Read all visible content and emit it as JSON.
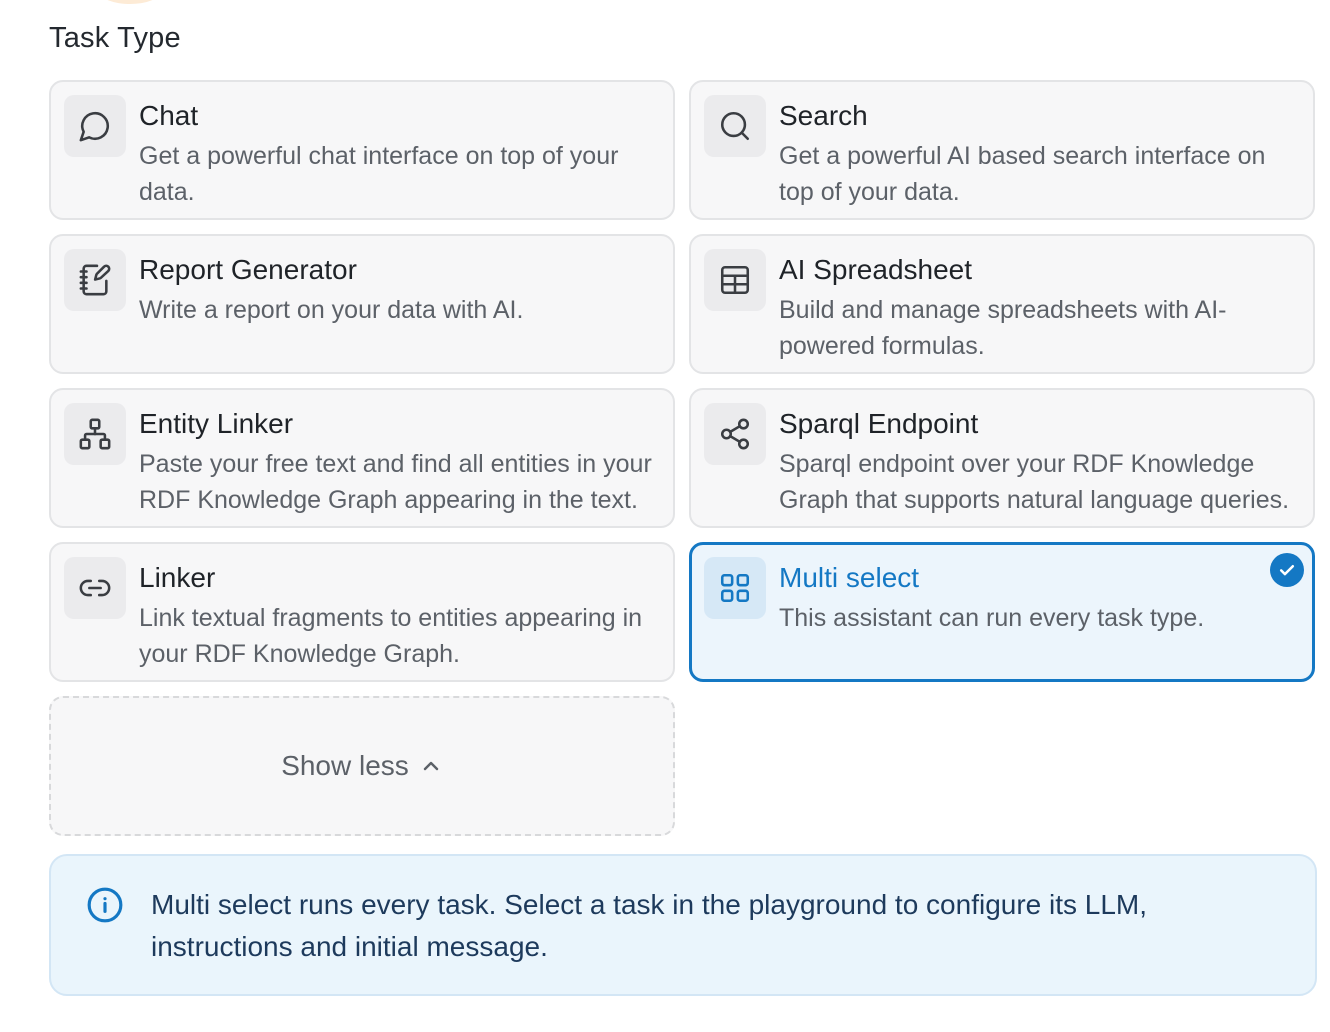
{
  "section_title": "Task Type",
  "tasks": [
    {
      "icon": "chat-bubble-icon",
      "title": "Chat",
      "description": "Get a powerful chat interface on top of your data."
    },
    {
      "icon": "search-icon",
      "title": "Search",
      "description": "Get a powerful AI based search interface on top of your data."
    },
    {
      "icon": "notebook-pen-icon",
      "title": "Report Generator",
      "description": "Write a report on your data with AI."
    },
    {
      "icon": "spreadsheet-icon",
      "title": "AI Spreadsheet",
      "description": "Build and manage spreadsheets with AI-powered formulas."
    },
    {
      "icon": "network-hierarchy-icon",
      "title": "Entity Linker",
      "description": "Paste your free text and find all entities in your RDF Knowledge Graph appearing in the text."
    },
    {
      "icon": "share-nodes-icon",
      "title": "Sparql Endpoint",
      "description": "Sparql endpoint over your RDF Knowledge Graph that supports natural language queries."
    },
    {
      "icon": "link-icon",
      "title": "Linker",
      "description": "Link textual fragments to entities appearing in your RDF Knowledge Graph."
    },
    {
      "icon": "grid-icon",
      "title": "Multi select",
      "description": "This assistant can run every task type.",
      "selected": true
    }
  ],
  "show_less": {
    "label": "Show less",
    "icon": "chevron-up-icon"
  },
  "info": {
    "icon": "info-circle-icon",
    "text": "Multi select runs every task. Select a task in the playground to configure its LLM, instructions and initial message."
  },
  "colors": {
    "accent": "#1478c4",
    "card_bg": "#f7f7f8",
    "info_bg": "#eaf5fc"
  }
}
